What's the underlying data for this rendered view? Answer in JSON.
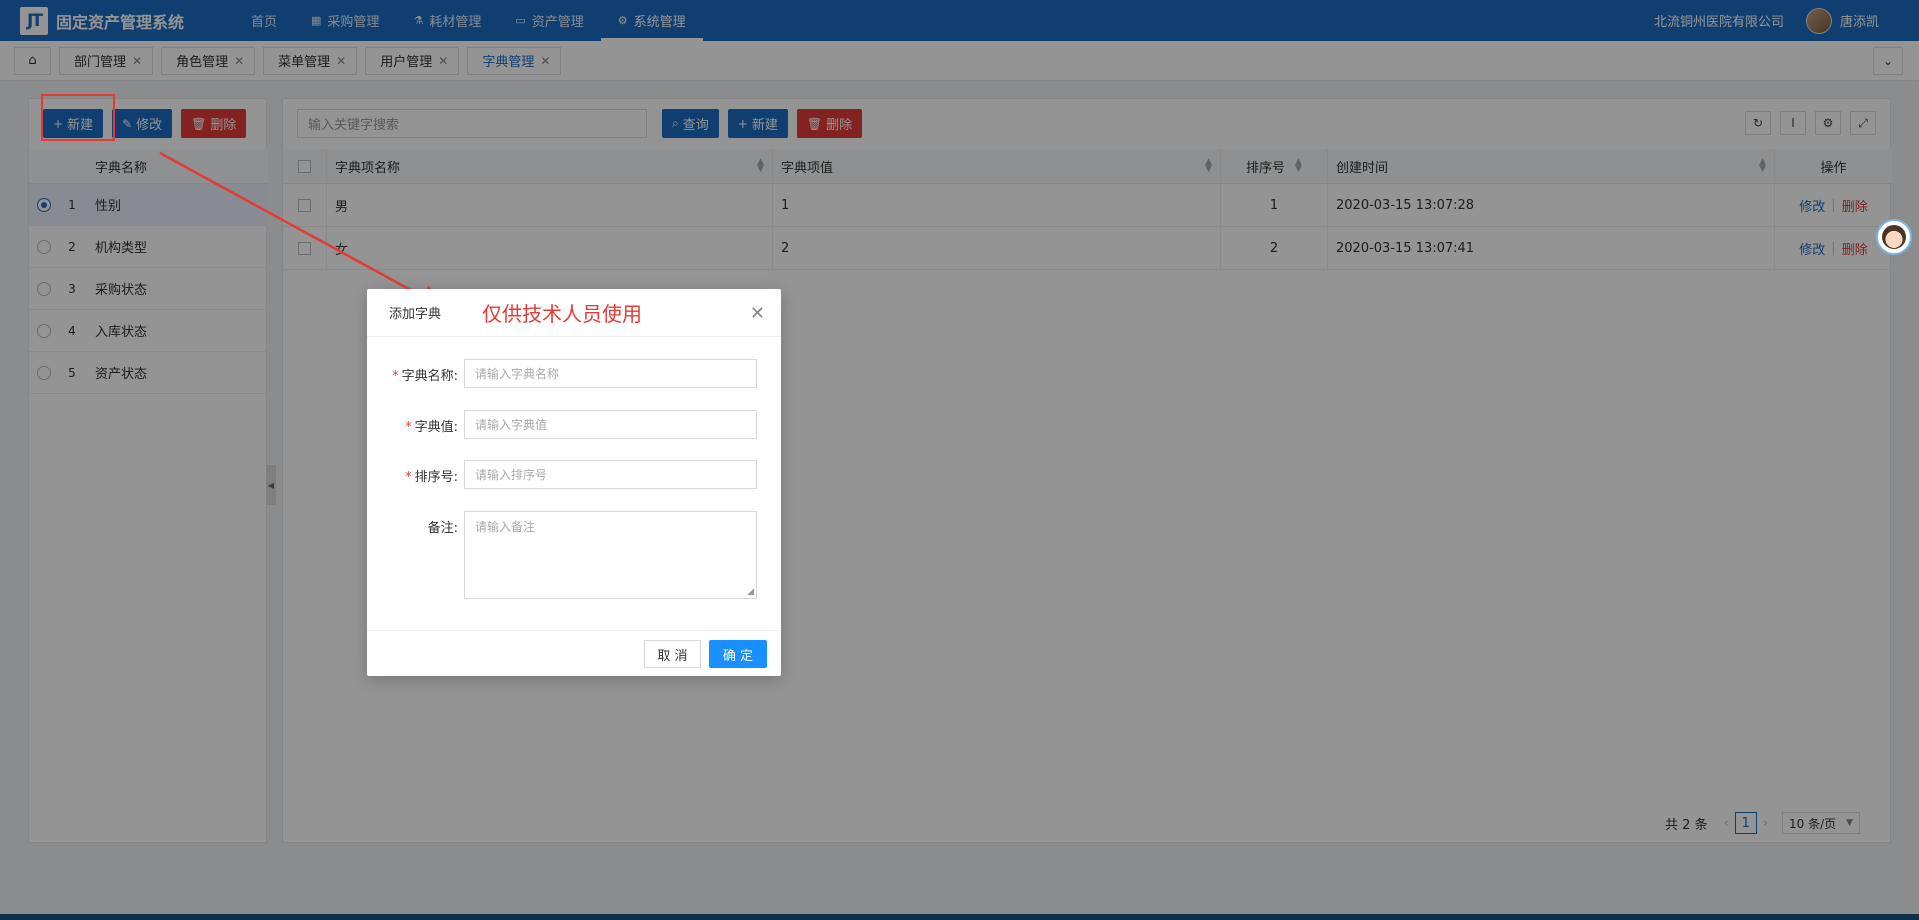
{
  "app": {
    "logo_mark": "JT",
    "title": "固定资产管理系统",
    "hospital": "北流铜州医院有限公司",
    "username": "唐添凯"
  },
  "nav": [
    {
      "label": "首页",
      "icon": ""
    },
    {
      "label": "采购管理",
      "icon": "cart-icon"
    },
    {
      "label": "耗材管理",
      "icon": "box-icon"
    },
    {
      "label": "资产管理",
      "icon": "calendar-icon"
    },
    {
      "label": "系统管理",
      "icon": "gear-icon"
    }
  ],
  "tabs": [
    {
      "label": "部门管理"
    },
    {
      "label": "角色管理"
    },
    {
      "label": "菜单管理"
    },
    {
      "label": "用户管理"
    },
    {
      "label": "字典管理"
    }
  ],
  "left": {
    "new_label": "新建",
    "edit_label": "修改",
    "delete_label": "删除",
    "column_header": "字典名称",
    "rows": [
      {
        "num": "1",
        "name": "性别"
      },
      {
        "num": "2",
        "name": "机构类型"
      },
      {
        "num": "3",
        "name": "采购状态"
      },
      {
        "num": "4",
        "name": "入库状态"
      },
      {
        "num": "5",
        "name": "资产状态"
      }
    ]
  },
  "right": {
    "search_placeholder": "输入关键字搜索",
    "query_label": "查询",
    "new_label": "新建",
    "delete_label": "删除",
    "headers": {
      "name": "字典项名称",
      "value": "字典项值",
      "sort": "排序号",
      "time": "创建时间",
      "op": "操作"
    },
    "rows": [
      {
        "name": "男",
        "value": "1",
        "sort": "1",
        "time": "2020-03-15 13:07:28",
        "edit": "修改",
        "del": "删除"
      },
      {
        "name": "女",
        "value": "2",
        "sort": "2",
        "time": "2020-03-15 13:07:41",
        "edit": "修改",
        "del": "删除"
      }
    ],
    "pagination": {
      "total": "共 2 条",
      "page": "1",
      "page_size": "10 条/页"
    }
  },
  "modal": {
    "title": "添加字典",
    "fields": {
      "name_label": "字典名称:",
      "name_placeholder": "请输入字典名称",
      "value_label": "字典值:",
      "value_placeholder": "请输入字典值",
      "sort_label": "排序号:",
      "sort_placeholder": "请输入排序号",
      "remark_label": "备注:",
      "remark_placeholder": "请输入备注"
    },
    "cancel_label": "取 消",
    "ok_label": "确 定"
  },
  "annotation": {
    "text": "仅供技术人员使用",
    "color": "#e53935"
  },
  "colors": {
    "primary": "#1d6cc1",
    "danger": "#e23c39",
    "ok_button": "#1890ff"
  }
}
